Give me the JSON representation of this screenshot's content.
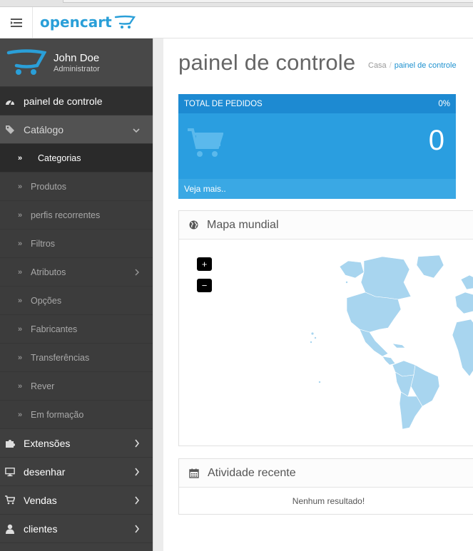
{
  "header": {
    "logo_text": "opencart",
    "menu_icon": "hamburger-menu-icon",
    "brand_color": "#2a9fd8"
  },
  "profile": {
    "name": "John Doe",
    "role": "Administrator"
  },
  "sidebar": {
    "items": [
      {
        "label": "painel de controle",
        "icon": "dashboard-icon"
      },
      {
        "label": "Catálogo",
        "icon": "tags-icon"
      },
      {
        "label": "Extensões",
        "icon": "puzzle-icon"
      },
      {
        "label": "desenhar",
        "icon": "desktop-icon"
      },
      {
        "label": "Vendas",
        "icon": "cart-icon"
      },
      {
        "label": "clientes",
        "icon": "user-icon"
      }
    ],
    "catalog_sub": [
      {
        "label": "Categorias"
      },
      {
        "label": "Produtos"
      },
      {
        "label": "perfis recorrentes"
      },
      {
        "label": "Filtros"
      },
      {
        "label": "Atributos"
      },
      {
        "label": "Opções"
      },
      {
        "label": "Fabricantes"
      },
      {
        "label": "Transferências"
      },
      {
        "label": "Rever"
      },
      {
        "label": "Em formação"
      }
    ]
  },
  "main": {
    "title": "painel de controle",
    "breadcrumb": {
      "home": "Casa",
      "sep": "/",
      "current": "painel de controle"
    },
    "orders_tile": {
      "title": "TOTAL DE PEDIDOS",
      "percent": "0%",
      "value": "0",
      "footer_link": "Veja mais..",
      "color": "#2a9ee0"
    },
    "map_panel": {
      "title": "Mapa mundial",
      "zoom_in": "+",
      "zoom_out": "−"
    },
    "activity_panel": {
      "title": "Atividade recente",
      "empty_text": "Nenhum resultado!"
    }
  }
}
